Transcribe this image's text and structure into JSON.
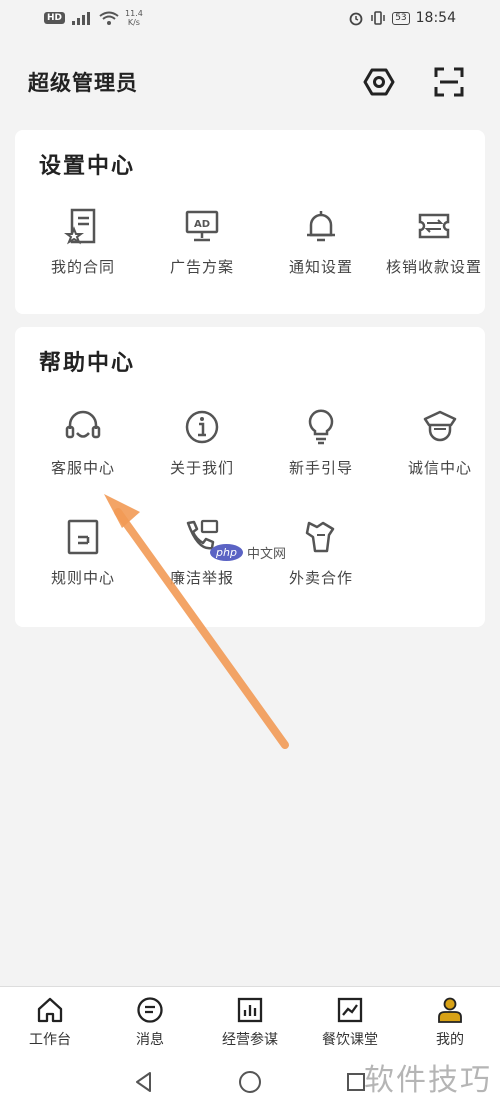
{
  "status_bar": {
    "hd": "HD",
    "net_speed_value": "11.4",
    "net_speed_unit": "K/s",
    "battery": "53",
    "time": "18:54"
  },
  "header": {
    "title": "超级管理员"
  },
  "settings_center": {
    "title": "设置中心",
    "items": [
      {
        "label": "我的合同",
        "icon": "contract-icon"
      },
      {
        "label": "广告方案",
        "icon": "ad-monitor-icon"
      },
      {
        "label": "通知设置",
        "icon": "bell-icon"
      },
      {
        "label": "核销收款设置",
        "icon": "ticket-icon"
      }
    ]
  },
  "help_center": {
    "title": "帮助中心",
    "items": [
      {
        "label": "客服中心",
        "icon": "headset-icon"
      },
      {
        "label": "关于我们",
        "icon": "info-icon"
      },
      {
        "label": "新手引导",
        "icon": "lightbulb-icon"
      },
      {
        "label": "诚信中心",
        "icon": "police-badge-icon"
      },
      {
        "label": "规则中心",
        "icon": "rules-doc-icon"
      },
      {
        "label": "廉洁举报",
        "icon": "report-phone-icon"
      },
      {
        "label": "外卖合作",
        "icon": "delivery-icon"
      }
    ]
  },
  "tab_bar": {
    "items": [
      {
        "label": "工作台",
        "icon": "home-icon"
      },
      {
        "label": "消息",
        "icon": "message-icon"
      },
      {
        "label": "经营参谋",
        "icon": "bar-chart-icon"
      },
      {
        "label": "餐饮课堂",
        "icon": "line-chart-icon"
      },
      {
        "label": "我的",
        "icon": "user-icon",
        "active": true
      }
    ]
  },
  "watermarks": {
    "site": "软件技巧",
    "php_logo": "php",
    "php_text": "中文网"
  },
  "colors": {
    "accent": "#d8a216",
    "arrow": "#f29a55"
  }
}
